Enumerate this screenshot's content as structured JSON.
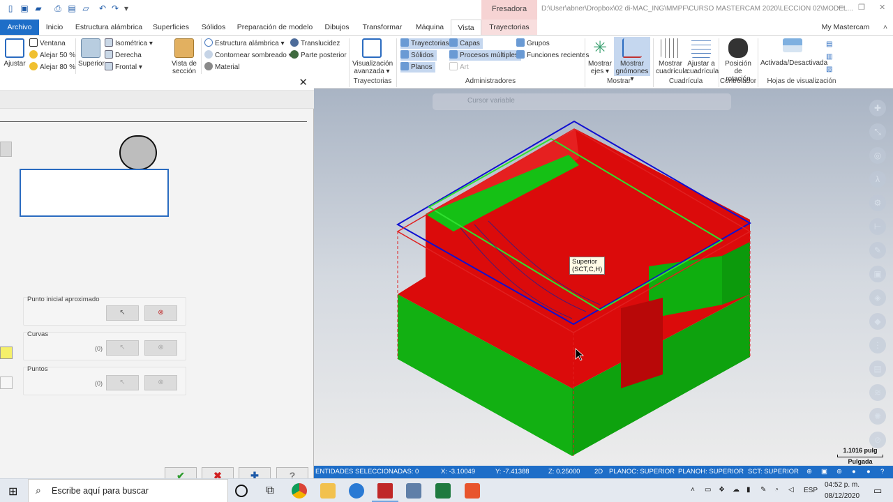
{
  "titlebar": {
    "context_tab": "Fresadora",
    "window_title": "D:\\User\\abner\\Dropbox\\02 di-MAC_ING\\MMPF\\CURSO MASTERCAM 2020\\LECCION 02\\MODEL..."
  },
  "tabs": [
    "Archivo",
    "Inicio",
    "Estructura alámbrica",
    "Superficies",
    "Sólidos",
    "Preparación de modelo",
    "Dibujos",
    "Transformar",
    "Máquina",
    "Vista",
    "Trayectorias"
  ],
  "account": "My Mastercam",
  "ribbon": {
    "ajustar": "Ajustar",
    "ventana": "Ventana",
    "alejar50": "Alejar 50 %",
    "alejar80": "Alejar 80 %",
    "superior": "Superior",
    "isometrica": "Isométrica",
    "derecha": "Derecha",
    "frontal": "Frontal",
    "vista_seccion": "Vista de sección",
    "estructura": "Estructura alámbrica",
    "contornear": "Contornear sombreado",
    "material": "Material",
    "translucidez": "Translucidez",
    "parte_posterior": "Parte posterior",
    "visualizacion": "Visualización avanzada",
    "trayectorias": "Trayectorias",
    "solidos": "Sólidos",
    "planos": "Planos",
    "capas": "Capas",
    "procesos": "Procesos múltiples",
    "art": "Art",
    "grupos": "Grupos",
    "funciones": "Funciones recientes",
    "mostrar_ejes": "Mostrar ejes",
    "mostrar_gnomones": "Mostrar gnómones",
    "mostrar_cuadricula": "Mostrar cuadrícula",
    "ajustar_cuadricula": "Ajustar a cuadrícula",
    "posicion_rotacion": "Posición de rotación",
    "activada": "Activada/Desactivada",
    "groups": {
      "trayectorias": "Trayectorias",
      "administradores": "Administradores",
      "mostrar": "Mostrar",
      "cuadricula": "Cuadrícula",
      "controlador": "Controlador",
      "hojas": "Hojas de visualización"
    }
  },
  "dialog": {
    "punto_inicial": "Punto inicial aproximado",
    "curvas": "Curvas",
    "curvas_count": "(0)",
    "puntos": "Puntos",
    "puntos_count": "(0)"
  },
  "viewport": {
    "floating_toolbar": "Cursor variable",
    "tooltip_line1": "Superior",
    "tooltip_line2": "(SCT,C,H)",
    "scale_value": "1.1016 pulg",
    "scale_unit": "Pulgada"
  },
  "status": {
    "entidades": "ENTIDADES SELECCIONADAS: 0",
    "x": "X:   -3.10049",
    "y": "Y:   -7.41388",
    "z": "Z:   0.25000",
    "mode": "2D",
    "planoc": "PLANOC: SUPERIOR",
    "planoh": "PLANOH: SUPERIOR",
    "sct": "SCT: SUPERIOR"
  },
  "taskbar": {
    "search_placeholder": "Escribe aquí para buscar",
    "lang": "ESP",
    "time": "04:52 p. m.",
    "date": "08/12/2020"
  },
  "colors": {
    "accent": "#1e6ec8",
    "model_red": "#dd0a0a",
    "model_green": "#10b410"
  }
}
